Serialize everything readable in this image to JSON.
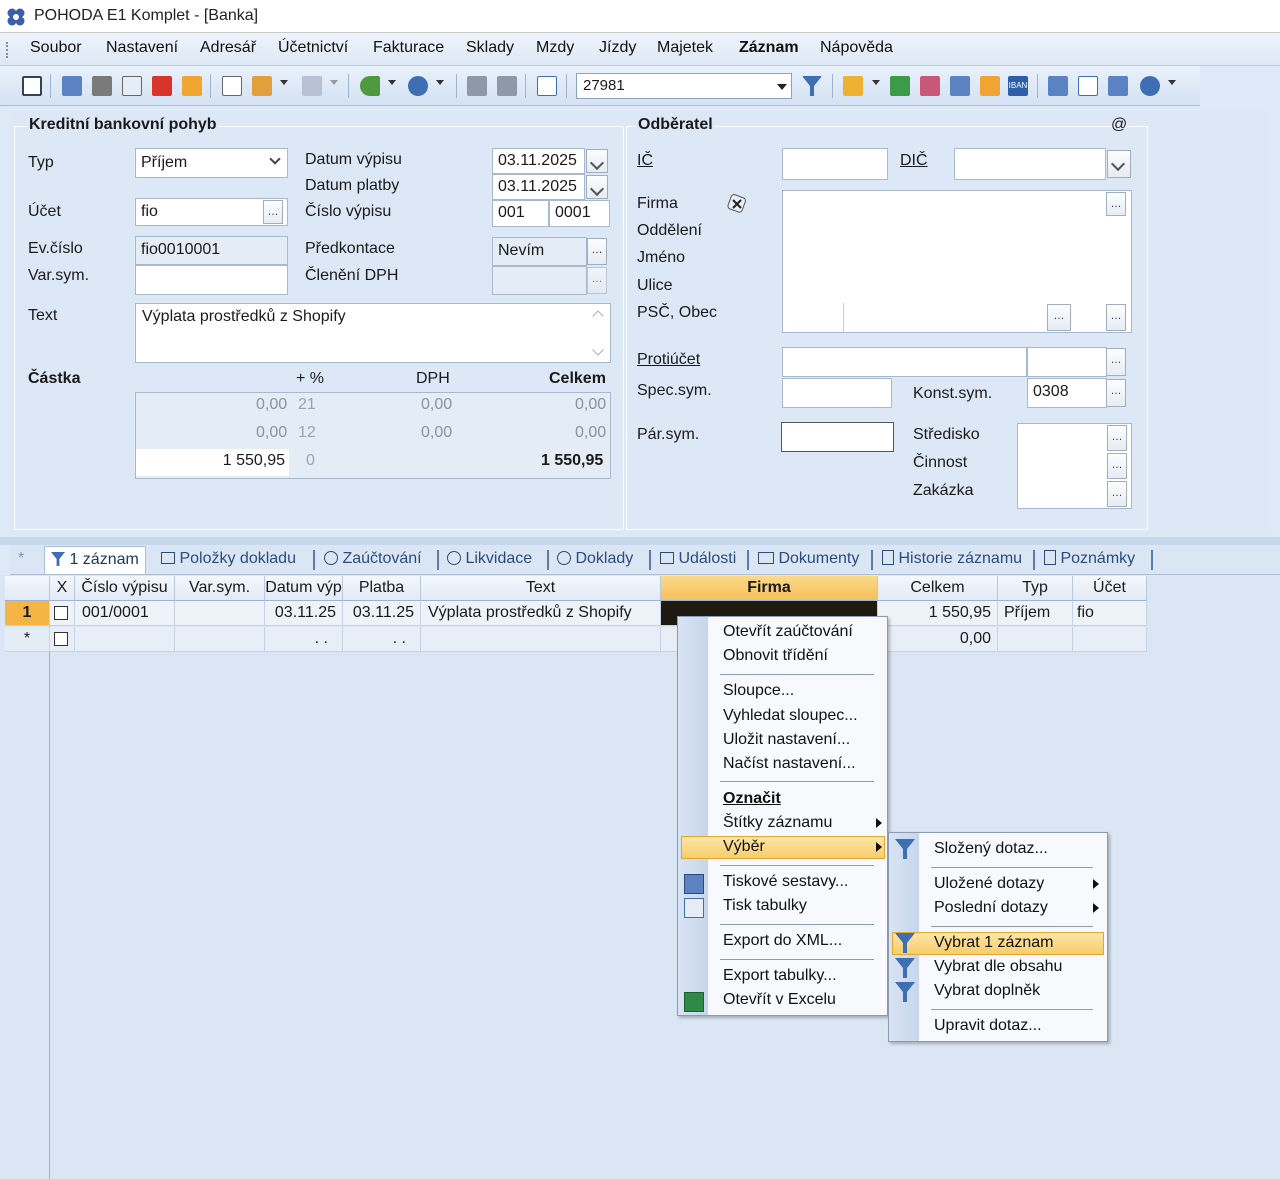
{
  "window": {
    "title": "POHODA E1 Komplet - [Banka]"
  },
  "menubar": [
    {
      "label": "Soubor"
    },
    {
      "label": "Nastavení"
    },
    {
      "label": "Adresář"
    },
    {
      "label": "Účetnictví"
    },
    {
      "label": "Fakturace"
    },
    {
      "label": "Sklady"
    },
    {
      "label": "Mzdy"
    },
    {
      "label": "Jízdy"
    },
    {
      "label": "Majetek"
    },
    {
      "label": "Záznam"
    },
    {
      "label": "Nápověda"
    }
  ],
  "toolbar": {
    "record_number": "27981",
    "iban_label": "IBAN"
  },
  "form": {
    "section_left_title": "Kreditní bankovní pohyb",
    "typ_label": "Typ",
    "typ_value": "Příjem",
    "ucet_label": "Účet",
    "ucet_value": "fio",
    "ev_cislo_label": "Ev.číslo",
    "ev_cislo_value": "fio0010001",
    "var_sym_label": "Var.sym.",
    "var_sym_value": "",
    "datum_vypisu_label": "Datum výpisu",
    "datum_vypisu_value": "03.11.2025",
    "datum_platby_label": "Datum platby",
    "datum_platby_value": "03.11.2025",
    "cislo_vypisu_label": "Číslo výpisu",
    "cislo_vypisu_a": "001",
    "cislo_vypisu_b": "0001",
    "predkontace_label": "Předkontace",
    "predkontace_value": "Nevím",
    "cleneni_dph_label": "Členění DPH",
    "cleneni_dph_value": "",
    "text_label": "Text",
    "text_value": "Výplata prostředků z Shopify",
    "castka_label": "Částka",
    "col_pct": "+ %",
    "col_dph": "DPH",
    "col_celkem": "Celkem",
    "amount_rows": [
      {
        "base": "0,00",
        "pct": "21",
        "dph": "0,00",
        "total": "0,00"
      },
      {
        "base": "0,00",
        "pct": "12",
        "dph": "0,00",
        "total": "0,00"
      },
      {
        "base": "1 550,95",
        "pct": "0",
        "dph": "",
        "total": "1 550,95"
      }
    ],
    "section_right_title": "Odběratel",
    "at_symbol": "@",
    "ic_label": "IČ",
    "dic_label": "DIČ",
    "firma_label": "Firma",
    "oddeleni_label": "Oddělení",
    "jmeno_label": "Jméno",
    "ulice_label": "Ulice",
    "psc_label": "PSČ, Obec",
    "protiucet_label": "Protiúčet",
    "spec_sym_label": "Spec.sym.",
    "konst_sym_label": "Konst.sym.",
    "konst_sym_value": "0308",
    "par_sym_label": "Pár.sym.",
    "stredisko_label": "Středisko",
    "cinnost_label": "Činnost",
    "zakazka_label": "Zakázka"
  },
  "tabs": [
    {
      "label": "*"
    },
    {
      "label": "1 záznam"
    },
    {
      "label": "Položky dokladu"
    },
    {
      "label": "Zaúčtování"
    },
    {
      "label": "Likvidace"
    },
    {
      "label": "Doklady"
    },
    {
      "label": "Události"
    },
    {
      "label": "Dokumenty"
    },
    {
      "label": "Historie záznamu"
    },
    {
      "label": "Poznámky"
    }
  ],
  "grid": {
    "headers": [
      "X",
      "Číslo výpisu",
      "Var.sym.",
      "Datum výp",
      "Platba",
      "Text",
      "Firma",
      "Celkem",
      "Typ",
      "Účet"
    ],
    "rows": [
      {
        "num": "1",
        "cislo": "001/0001",
        "varsym": "",
        "datum": "03.11.25",
        "platba": "03.11.25",
        "text": "Výplata prostředků z Shopify",
        "firma": "",
        "celkem": "1 550,95",
        "typ": "Příjem",
        "ucet": "fio"
      },
      {
        "num": "*",
        "cislo": "",
        "varsym": "",
        "datum": ". .",
        "platba": ". .",
        "text": "",
        "firma": "",
        "celkem": "0,00",
        "typ": "",
        "ucet": ""
      }
    ]
  },
  "context_menu": {
    "items": [
      "Otevřít zaúčtování",
      "Obnovit třídění",
      "Sloupce...",
      "Vyhledat sloupec...",
      "Uložit nastavení...",
      "Načíst nastavení...",
      "Označit",
      "Štítky záznamu",
      "Výběr",
      "Tiskové sestavy...",
      "Tisk tabulky",
      "Export do XML...",
      "Export tabulky...",
      "Otevřít v Excelu"
    ]
  },
  "submenu": {
    "items": [
      "Složený dotaz...",
      "Uložené dotazy",
      "Poslední dotazy",
      "Vybrat 1 záznam",
      "Vybrat dle obsahu",
      "Vybrat doplněk",
      "Upravit dotaz..."
    ]
  }
}
